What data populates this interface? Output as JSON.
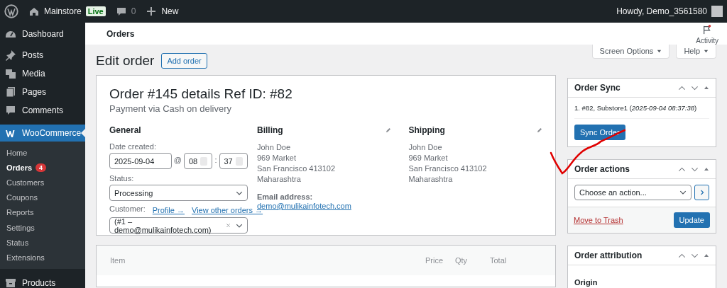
{
  "admin_bar": {
    "items": [
      {
        "kind": "logo"
      },
      {
        "kind": "site",
        "label": "Mainstore",
        "badge": "Live"
      },
      {
        "kind": "comments",
        "label": "0"
      },
      {
        "kind": "new",
        "label": "New"
      }
    ],
    "account": "Howdy, Demo_3561580"
  },
  "sidebar": {
    "items": [
      {
        "label": "Dashboard",
        "kind": "dashboard",
        "selected": false
      },
      {
        "label": "Posts",
        "kind": "posts",
        "selected": false
      },
      {
        "label": "Media",
        "kind": "media",
        "selected": false
      },
      {
        "label": "Pages",
        "kind": "pages",
        "selected": false
      },
      {
        "label": "Comments",
        "kind": "comments",
        "selected": false
      },
      {
        "label": "WooCommerce",
        "kind": "woo",
        "selected": true,
        "children": [
          {
            "label": "Home",
            "selected": false
          },
          {
            "label": "Orders",
            "selected": true,
            "badge": "4"
          },
          {
            "label": "Customers",
            "selected": false
          },
          {
            "label": "Coupons",
            "selected": false
          },
          {
            "label": "Reports",
            "selected": false
          },
          {
            "label": "Settings",
            "selected": false
          },
          {
            "label": "Status",
            "selected": false
          },
          {
            "label": "Extensions",
            "selected": false
          }
        ]
      },
      {
        "label": "Products",
        "kind": "products",
        "selected": false
      }
    ]
  },
  "header": {
    "title": "Orders",
    "activity": "Activity"
  },
  "screen_tabs": [
    "Screen Options",
    "Help"
  ],
  "page_title": "Edit order",
  "add_button": "Add order",
  "order": {
    "heading": "Order #145 details Ref ID: #82",
    "payment": "Payment via Cash on delivery",
    "general": {
      "title": "General",
      "date_label": "Date created:",
      "date": "2025-09-04",
      "date_at": "@",
      "hour": "08",
      "time_sep": ":",
      "minute": "37",
      "status_label": "Status:",
      "status": "Processing",
      "customer_label": "Customer:",
      "profile_link": "Profile →",
      "orders_link": "View other orders →",
      "customer": "(#1 – demo@mulikainfotech.com)"
    },
    "billing": {
      "title": "Billing",
      "lines": [
        "John Doe",
        "969 Market",
        "San Francisco 413102",
        "Maharashtra"
      ],
      "email_label": "Email address:",
      "email": "demo@mulikainfotech.com"
    },
    "shipping": {
      "title": "Shipping",
      "lines": [
        "John Doe",
        "969 Market",
        "San Francisco 413102",
        "Maharashtra"
      ]
    }
  },
  "items_table": {
    "columns": [
      "Item",
      "Price",
      "Qty",
      "Total"
    ]
  },
  "order_sync": {
    "title": "Order Sync",
    "entries": [
      "1. #82, Substore1 (*2025-09-04 08:37:38*)"
    ],
    "button": "Sync Order"
  },
  "order_actions": {
    "title": "Order actions",
    "placeholder": "Choose an action...",
    "trash": "Move to Trash",
    "update": "Update"
  },
  "order_attribution": {
    "title": "Order attribution",
    "origin_label": "Origin"
  },
  "annotation": {
    "kind": "checkmark"
  }
}
